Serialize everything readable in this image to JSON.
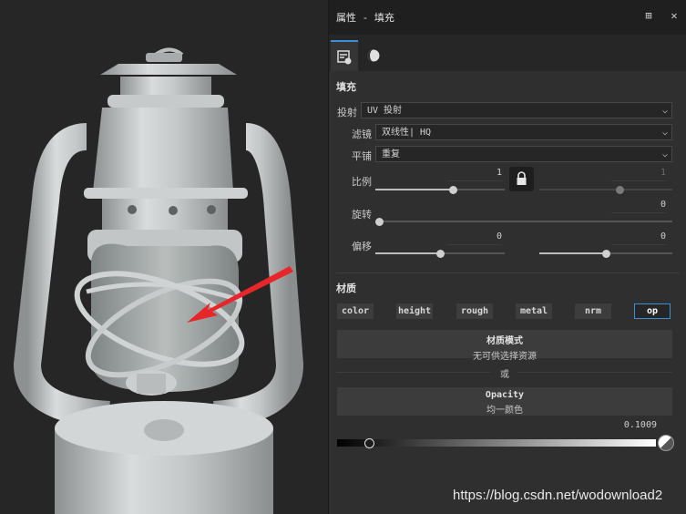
{
  "panel": {
    "title": "属性 - 填充",
    "section_fill": "填充",
    "projection": {
      "label": "投射",
      "value": "UV 投射"
    },
    "filter": {
      "label": "滤镜",
      "value": "双线性| HQ"
    },
    "tiling": {
      "label": "平铺",
      "value": "重复"
    },
    "scale": {
      "label": "比例",
      "value_left": "1",
      "value_right": "1",
      "slider_left": 0.6,
      "slider_right": 0.6
    },
    "rotation": {
      "label": "旋转",
      "value": "0",
      "slider": 0.0
    },
    "offset": {
      "label": "偏移",
      "value_left": "0",
      "value_right": "0",
      "slider_left": 0.5,
      "slider_right": 0.5
    },
    "section_material": "材质",
    "channels": [
      "color",
      "height",
      "rough",
      "metal",
      "nrm",
      "op"
    ],
    "active_channel": "op",
    "material_mode": {
      "title": "材质模式",
      "subtitle": "无可供选择资源"
    },
    "or_text": "或",
    "opacity": {
      "title": "Opacity",
      "subtitle": "均一颜色",
      "value": "0.1009",
      "slider": 0.1
    }
  },
  "watermark": "https://blog.csdn.net/wodownload2",
  "colors": {
    "accent": "#3c8fd6",
    "arrow": "#e8262a",
    "panel_bg": "#2f2f2f",
    "viewport_bg": "#262626"
  }
}
